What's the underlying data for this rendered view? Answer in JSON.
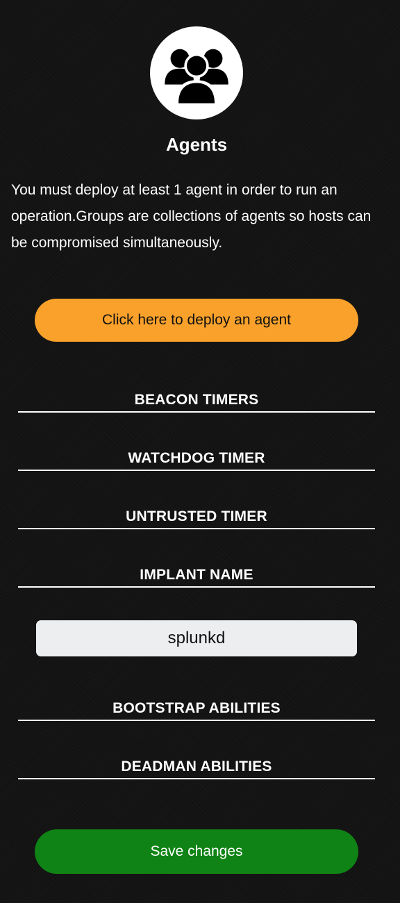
{
  "header": {
    "icon": "users-group-icon",
    "title": "Agents"
  },
  "description": "You must deploy at least 1 agent in order to run an operation.Groups are collections of agents so hosts can be compromised simultaneously.",
  "deploy_button": {
    "label": "Click here to deploy an agent",
    "color": "#f9a12b"
  },
  "sections": {
    "beacon_timers": "BEACON TIMERS",
    "watchdog_timer": "WATCHDOG TIMER",
    "untrusted_timer": "UNTRUSTED TIMER",
    "implant_name": "IMPLANT NAME",
    "bootstrap_abilities": "BOOTSTRAP ABILITIES",
    "deadman_abilities": "DEADMAN ABILITIES"
  },
  "implant_name_input": {
    "value": "splunkd"
  },
  "save_button": {
    "label": "Save changes",
    "color": "#0f8315"
  }
}
